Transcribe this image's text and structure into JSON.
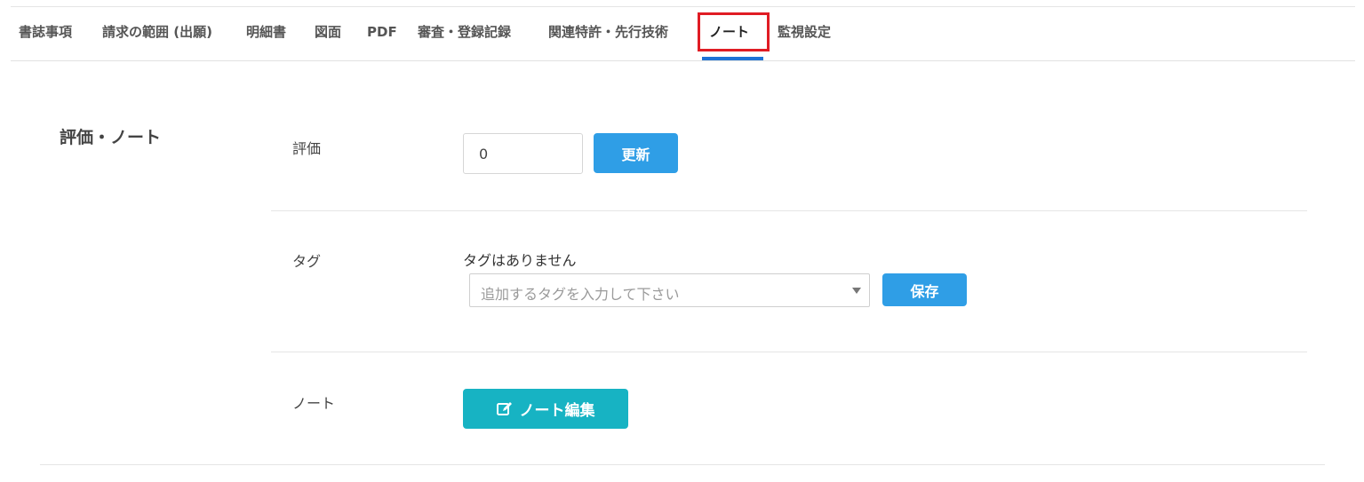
{
  "tabs": [
    {
      "label": "書誌事項"
    },
    {
      "label": "請求の範囲 (出願)"
    },
    {
      "label": "明細書"
    },
    {
      "label": "図面"
    },
    {
      "label": "PDF"
    },
    {
      "label": "審査・登録記録"
    },
    {
      "label": "関連特許・先行技術"
    },
    {
      "label": "ノート",
      "active": true
    },
    {
      "label": "監視設定"
    }
  ],
  "section": {
    "title": "評価・ノート",
    "rating": {
      "label": "評価",
      "value": "0",
      "update_button": "更新"
    },
    "tags": {
      "label": "タグ",
      "empty_message": "タグはありません",
      "placeholder": "追加するタグを入力して下さい",
      "save_button": "保存"
    },
    "note": {
      "label": "ノート",
      "edit_button": "ノート編集",
      "edit_icon": "edit-icon"
    }
  },
  "colors": {
    "primary_button": "#2f9ee6",
    "note_button": "#17b3c3",
    "active_tab_underline": "#1e72d6",
    "highlight_box": "#e01c24"
  }
}
